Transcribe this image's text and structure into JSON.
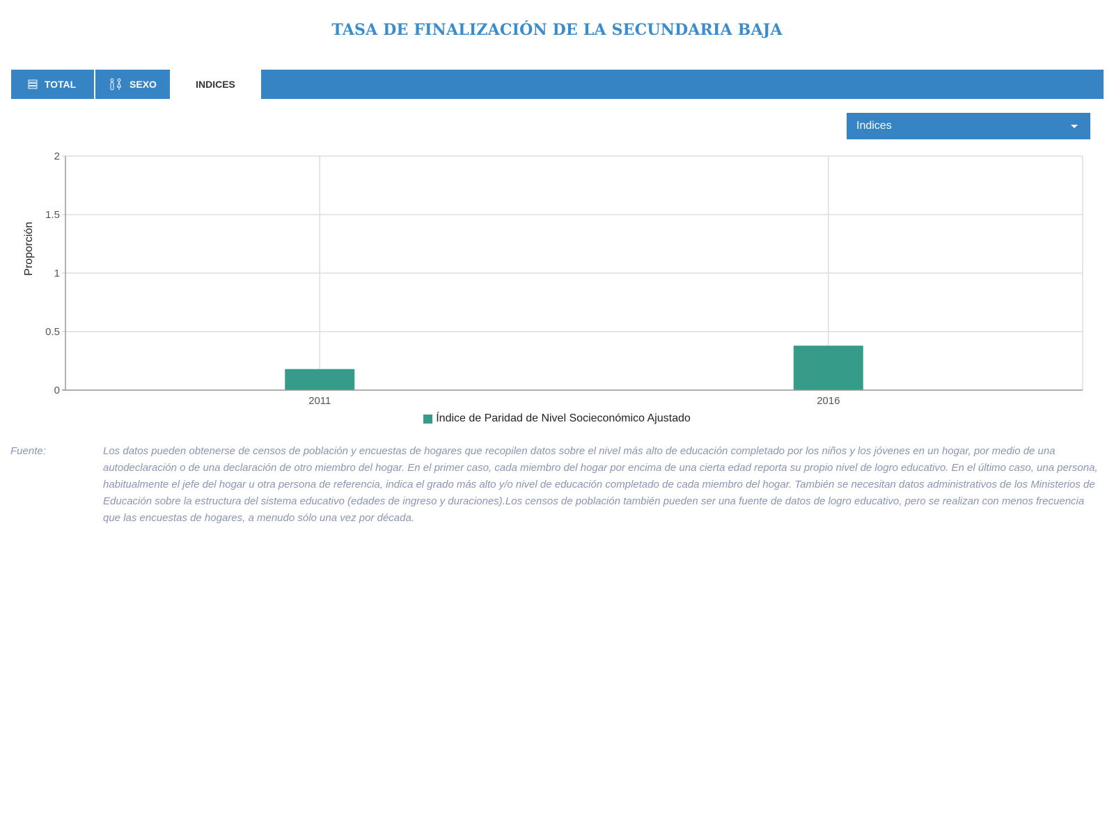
{
  "title": "TASA DE FINALIZACIÓN DE LA SECUNDARIA BAJA",
  "tabs": [
    {
      "label": "TOTAL",
      "icon": "bars-icon",
      "active": false
    },
    {
      "label": "SEXO",
      "icon": "gender-icon",
      "active": false
    },
    {
      "label": "INDICES",
      "icon": "",
      "active": true
    }
  ],
  "dropdown": {
    "selected": "Indices"
  },
  "colors": {
    "accent": "#3784c4",
    "title": "#3a8ccc",
    "bar": "#379b8a",
    "source_text": "#8a95b5"
  },
  "chart_data": {
    "type": "bar",
    "categories": [
      "2011",
      "2016"
    ],
    "series": [
      {
        "name": "Índice de Paridad de Nivel Socieconómico Ajustado",
        "values": [
          0.18,
          0.38
        ],
        "color": "#379b8a"
      }
    ],
    "xlabel": "",
    "ylabel": "Proporción",
    "ylim": [
      0,
      2
    ],
    "yticks": [
      "0",
      "0.5",
      "1",
      "1.5",
      "2"
    ],
    "grid": true,
    "legend_position": "bottom"
  },
  "source": {
    "label": "Fuente:",
    "text": "Los datos pueden obtenerse de censos de población y encuestas de hogares que recopilen datos sobre el nivel más alto de educación completado por los niños y los jóvenes en un hogar, por medio de una autodeclaración o de una declaración de otro miembro del hogar. En el primer caso, cada miembro del hogar por encima de una cierta edad reporta su propio nivel de logro educativo. En el último caso, una persona, habitualmente el jefe del hogar u otra persona de referencia, indica el grado más alto y/o nivel de educación completado de cada miembro del hogar. También se necesitan datos administrativos de los Ministerios de Educación sobre la estructura del sistema educativo (edades de ingreso y duraciones).Los censos de población también pueden ser una fuente de datos de logro educativo, pero se realizan con menos frecuencia que las encuestas de hogares, a menudo sólo una vez por década."
  }
}
